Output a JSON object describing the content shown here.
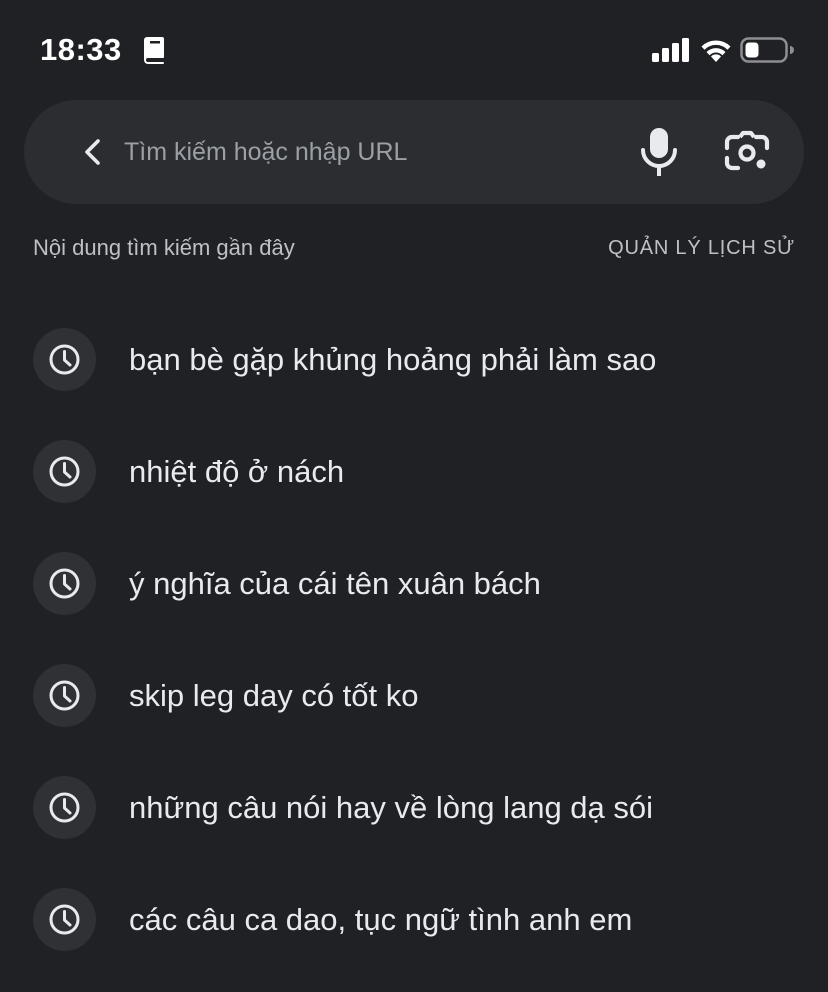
{
  "status_bar": {
    "time": "18:33"
  },
  "search": {
    "placeholder": "Tìm kiếm hoặc nhập URL"
  },
  "recent": {
    "title": "Nội dung tìm kiếm gần đây",
    "manage_label": "QUẢN LÝ LỊCH SỬ",
    "items": [
      {
        "label": "bạn bè gặp khủng hoảng phải làm sao",
        "icon": "history-clock-icon"
      },
      {
        "label": "nhiệt độ ở nách",
        "icon": "history-clock-icon"
      },
      {
        "label": "ý nghĩa của cái tên xuân bách",
        "icon": "history-clock-icon"
      },
      {
        "label": "skip leg day có tốt ko",
        "icon": "history-clock-icon"
      },
      {
        "label": "những câu nói hay về lòng lang dạ sói",
        "icon": "history-clock-icon"
      },
      {
        "label": "các câu ca dao, tục ngữ tình anh em",
        "icon": "history-clock-icon"
      }
    ]
  },
  "icons": {
    "book": "book-icon",
    "signal": "cellular-signal-icon",
    "wifi": "wifi-icon",
    "battery": "battery-icon",
    "back": "back-arrow-icon",
    "mic": "microphone-icon",
    "lens": "camera-lens-icon"
  },
  "colors": {
    "background": "#202124",
    "search_bar": "#2c2d30",
    "icon_circle": "#303134",
    "primary_text": "#e8eaed",
    "secondary_text": "#bdc1c6",
    "placeholder": "#9aa0a6"
  }
}
